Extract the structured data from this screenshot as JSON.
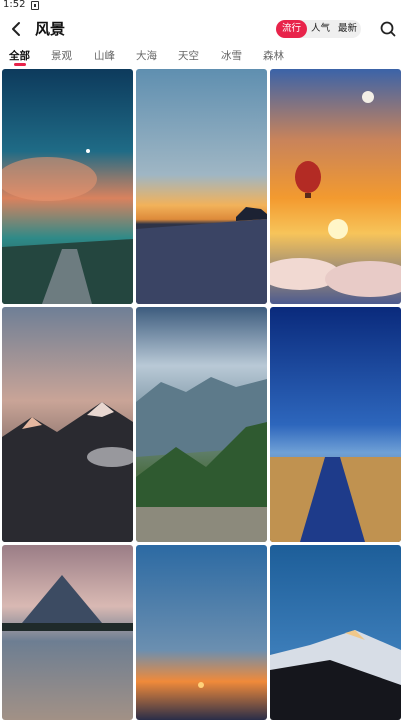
{
  "status_bar": {
    "time": "1:52"
  },
  "header": {
    "title": "风景",
    "sort_options": [
      "流行",
      "人气",
      "最新"
    ],
    "active_sort": "流行"
  },
  "tabs": [
    "全部",
    "景观",
    "山峰",
    "大海",
    "天空",
    "冰雪",
    "森林"
  ],
  "active_tab": "全部",
  "accent_color": "#e8234a",
  "wallpapers": [
    {
      "name": "twilight-lake-path"
    },
    {
      "name": "sunset-beach"
    },
    {
      "name": "hot-air-balloon-sunset"
    },
    {
      "name": "alpine-peaks-dusk"
    },
    {
      "name": "green-mountain-valley"
    },
    {
      "name": "field-road-blue-sky"
    },
    {
      "name": "lake-mountain-reflection"
    },
    {
      "name": "orange-horizon-sunset"
    },
    {
      "name": "snowy-peak-blue-sky"
    }
  ]
}
